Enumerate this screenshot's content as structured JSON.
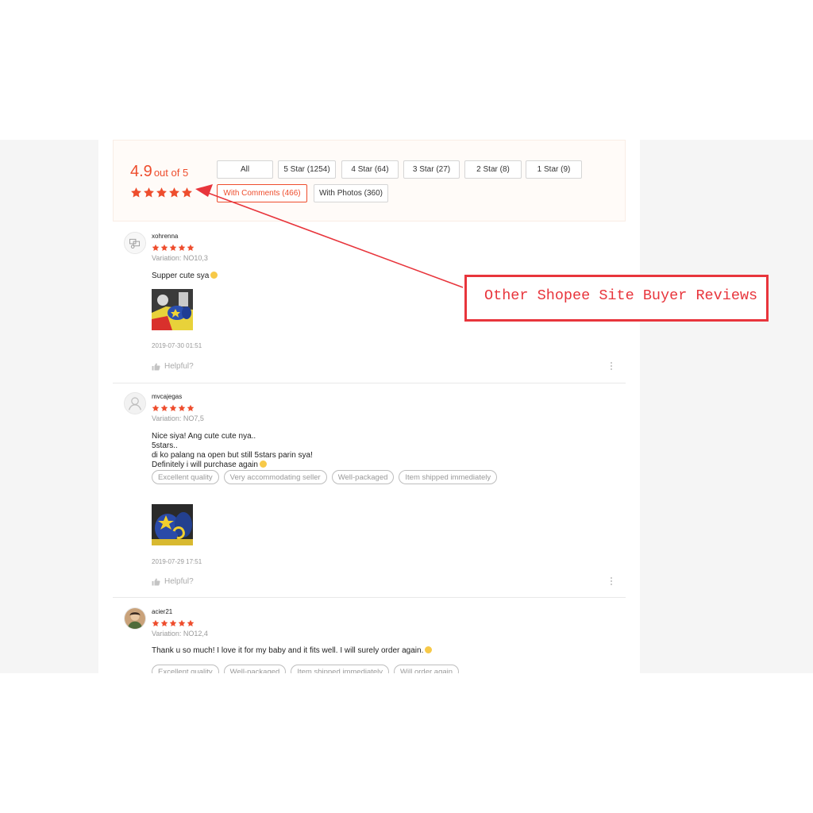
{
  "summary": {
    "rating": "4.9",
    "out_of": "out of 5",
    "filters": {
      "all": "All",
      "five": "5 Star (1254)",
      "four": "4 Star (64)",
      "three": "3 Star (27)",
      "two": "2 Star (8)",
      "one": "1 Star (9)",
      "comments": "With Comments (466)",
      "photos": "With Photos (360)"
    },
    "active_filter": "With Comments (466)"
  },
  "reviews": [
    {
      "username": "xohrenna",
      "stars": 5,
      "variation": "Variation: NO10,3",
      "comment": "Supper cute sya",
      "tags": [],
      "date": "2019-07-30 01:51",
      "helpful": "Helpful?"
    },
    {
      "username": "mvcajegas",
      "stars": 5,
      "variation": "Variation: NO7,5",
      "comment_lines": [
        "Nice siya! Ang cute cute nya..",
        "5stars..",
        "di ko palang na open but still 5stars parin sya!",
        "Definitely i will purchase again"
      ],
      "tags": [
        "Excellent quality",
        "Very accommodating seller",
        "Well-packaged",
        "Item shipped immediately"
      ],
      "date": "2019-07-29 17:51",
      "helpful": "Helpful?"
    },
    {
      "username": "acier21",
      "stars": 5,
      "variation": "Variation: NO12,4",
      "comment": "Thank u so much! I love it for my baby and it fits well. I will surely order again.",
      "tags": [
        "Excellent quality",
        "Well-packaged",
        "Item shipped immediately",
        "Will order again"
      ]
    }
  ],
  "annotation": {
    "text": "Other Shopee Site Buyer Reviews"
  },
  "colors": {
    "accent": "#ee4d2d",
    "annotation": "#e8353c"
  },
  "icons": [
    "star-icon",
    "user-avatar-icon",
    "thumbs-up-icon",
    "more-options-icon",
    "smile-emoji-icon",
    "arrow-annotation"
  ]
}
